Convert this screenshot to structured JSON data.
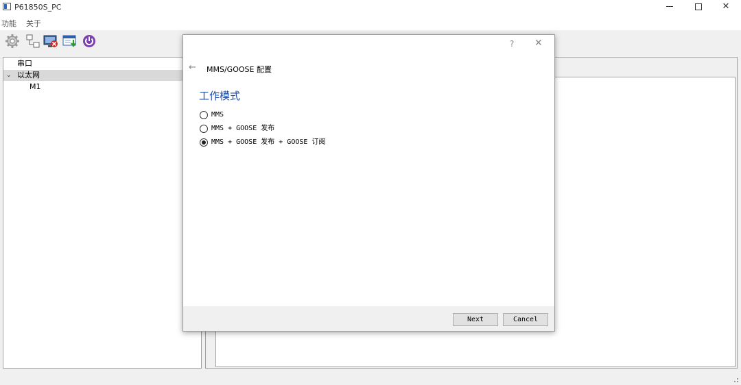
{
  "window": {
    "title": "P61850S_PC",
    "minimize": "",
    "maximize": "",
    "close": "✕"
  },
  "menu": {
    "items": [
      "功能",
      "关于"
    ]
  },
  "toolbar": {
    "icons": [
      "gear-icon",
      "network-icon",
      "disconnect-monitor-icon",
      "download-window-icon",
      "power-icon"
    ]
  },
  "tree": {
    "items": [
      {
        "label": "串口",
        "expanded": false
      },
      {
        "label": "以太网",
        "expanded": true,
        "toggle": "⌄"
      },
      {
        "label": "M1",
        "expanded": false
      }
    ]
  },
  "dialog": {
    "help": "?",
    "close": "✕",
    "back": "←",
    "header": "MMS/GOOSE 配置",
    "section_title": "工作模式",
    "options": [
      {
        "label": "MMS",
        "checked": false
      },
      {
        "label": "MMS + GOOSE 发布",
        "checked": false
      },
      {
        "label": "MMS + GOOSE 发布 + GOOSE 订阅",
        "checked": true
      }
    ],
    "next_label": "Next",
    "cancel_label": "Cancel"
  },
  "colors": {
    "accent": "#1f4aa8",
    "selection": "#d9d9d9",
    "background": "#f0f0f0"
  }
}
